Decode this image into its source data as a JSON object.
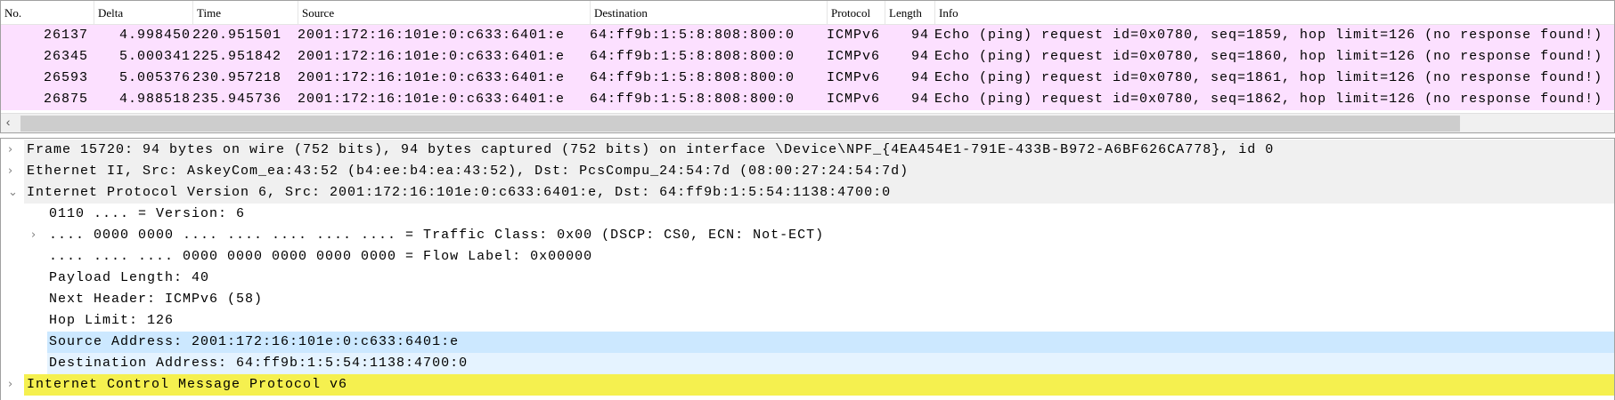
{
  "packet_list": {
    "columns": [
      "No.",
      "Delta",
      "Time",
      "Source",
      "Destination",
      "Protocol",
      "Length",
      "Info"
    ],
    "rows": [
      {
        "no": "26137",
        "delta": "4.998450",
        "time": "220.951501",
        "source": "2001:172:16:101e:0:c633:6401:e",
        "destination": "64:ff9b:1:5:8:808:800:0",
        "protocol": "ICMPv6",
        "length": "94",
        "info": "Echo (ping) request id=0x0780, seq=1859, hop limit=126 (no response found!)"
      },
      {
        "no": "26345",
        "delta": "5.000341",
        "time": "225.951842",
        "source": "2001:172:16:101e:0:c633:6401:e",
        "destination": "64:ff9b:1:5:8:808:800:0",
        "protocol": "ICMPv6",
        "length": "94",
        "info": "Echo (ping) request id=0x0780, seq=1860, hop limit=126 (no response found!)"
      },
      {
        "no": "26593",
        "delta": "5.005376",
        "time": "230.957218",
        "source": "2001:172:16:101e:0:c633:6401:e",
        "destination": "64:ff9b:1:5:8:808:800:0",
        "protocol": "ICMPv6",
        "length": "94",
        "info": "Echo (ping) request id=0x0780, seq=1861, hop limit=126 (no response found!)"
      },
      {
        "no": "26875",
        "delta": "4.988518",
        "time": "235.945736",
        "source": "2001:172:16:101e:0:c633:6401:e",
        "destination": "64:ff9b:1:5:8:808:800:0",
        "protocol": "ICMPv6",
        "length": "94",
        "info": "Echo (ping) request id=0x0780, seq=1862, hop limit=126 (no response found!)"
      }
    ],
    "row_color": "#fce0ff"
  },
  "details": [
    {
      "text": "Frame 15720: 94 bytes on wire (752 bits), 94 bytes captured (752 bits) on interface \\Device\\NPF_{4EA454E1-791E-433B-B972-A6BF626CA778}, id 0",
      "chevron": "›"
    },
    {
      "text": "Ethernet II, Src: AskeyCom_ea:43:52 (b4:ee:b4:ea:43:52), Dst: PcsCompu_24:54:7d (08:00:27:24:54:7d)",
      "chevron": "›"
    },
    {
      "text": "Internet Protocol Version 6, Src: 2001:172:16:101e:0:c633:6401:e, Dst: 64:ff9b:1:5:54:1138:4700:0",
      "chevron": "⌄"
    },
    {
      "text": "0110 .... = Version: 6"
    },
    {
      "text": ".... 0000 0000 .... .... .... .... .... = Traffic Class: 0x00 (DSCP: CS0, ECN: Not-ECT)",
      "chevron": "›"
    },
    {
      "text": ".... .... .... 0000 0000 0000 0000 0000 = Flow Label: 0x00000"
    },
    {
      "text": "Payload Length: 40"
    },
    {
      "text": "Next Header: ICMPv6 (58)"
    },
    {
      "text": "Hop Limit: 126"
    },
    {
      "text": "Source Address: 2001:172:16:101e:0:c633:6401:e"
    },
    {
      "text": "Destination Address: 64:ff9b:1:5:54:1138:4700:0"
    },
    {
      "text": "Internet Control Message Protocol v6",
      "chevron": "›"
    }
  ],
  "colors": {
    "header_rows": "#f0f0f0",
    "selected": "#cce8ff",
    "related": "#e5f3ff",
    "icmp": "#f5f04f"
  },
  "scrollbar": {
    "left_arrow": "‹"
  }
}
